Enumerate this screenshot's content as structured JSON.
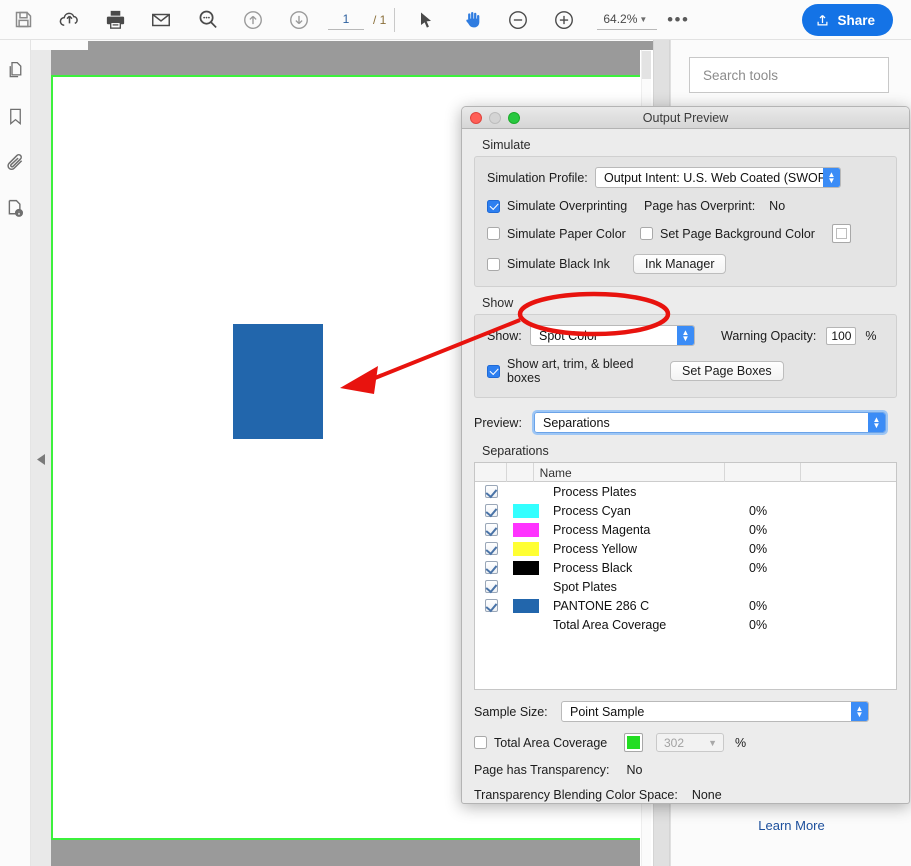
{
  "toolbar": {
    "icons": [
      "save-icon",
      "cloud-upload-icon",
      "print-icon",
      "email-icon",
      "search-zoom-icon",
      "page-up-icon",
      "page-down-icon",
      "select-cursor-icon",
      "hand-tool-icon",
      "zoom-out-icon",
      "zoom-in-icon"
    ],
    "page_number": "1",
    "page_total": "/ 1",
    "zoom_level": "64.2%",
    "more_label": "•••",
    "share_label": "Share"
  },
  "left_rail": {
    "items": [
      "page-thumbnails-icon",
      "bookmarks-icon",
      "attachments-icon",
      "document-info-icon"
    ]
  },
  "right_panel": {
    "search_placeholder": "Search tools",
    "learn_more_label": "Learn More"
  },
  "dialog": {
    "title": "Output Preview",
    "traffic_lights": [
      "close",
      "minimize",
      "zoom"
    ],
    "simulate": {
      "group_label": "Simulate",
      "profile_label": "Simulation Profile:",
      "profile_value": "Output Intent: U.S. Web Coated (SWOP)…",
      "overprint_checkbox_label": "Simulate Overprinting",
      "overprint_checked": true,
      "page_has_overprint_label": "Page has Overprint:",
      "page_has_overprint_value": "No",
      "paper_color_label": "Simulate Paper Color",
      "paper_color_checked": false,
      "set_page_bg_label": "Set Page Background Color",
      "set_page_bg_checked": false,
      "black_ink_label": "Simulate Black Ink",
      "black_ink_checked": false,
      "ink_manager_label": "Ink Manager"
    },
    "show": {
      "group_label": "Show",
      "show_label": "Show:",
      "show_value": "Spot Color",
      "warning_opacity_label": "Warning Opacity:",
      "warning_opacity_value": "100",
      "percent_label": "%",
      "boxes_checkbox_label": "Show art, trim, & bleed boxes",
      "boxes_checked": true,
      "set_page_boxes_label": "Set Page Boxes"
    },
    "preview": {
      "label": "Preview:",
      "value": "Separations"
    },
    "separations": {
      "group_label": "Separations",
      "columns": [
        "",
        "",
        "Name",
        "",
        ""
      ],
      "rows": [
        {
          "checked": true,
          "swatch": null,
          "name": "Process Plates",
          "pct": ""
        },
        {
          "checked": true,
          "swatch": "#33ffff",
          "name": "Process Cyan",
          "pct": "0%"
        },
        {
          "checked": true,
          "swatch": "#ff33ff",
          "name": "Process Magenta",
          "pct": "0%"
        },
        {
          "checked": true,
          "swatch": "#ffff33",
          "name": "Process Yellow",
          "pct": "0%"
        },
        {
          "checked": true,
          "swatch": "#000000",
          "name": "Process Black",
          "pct": "0%"
        },
        {
          "checked": true,
          "swatch": null,
          "name": "Spot Plates",
          "pct": ""
        },
        {
          "checked": true,
          "swatch": "#2266ac",
          "name": "PANTONE 286 C",
          "pct": "0%"
        },
        {
          "checked": false,
          "swatch": null,
          "name": "Total Area Coverage",
          "pct": "0%"
        }
      ]
    },
    "footer": {
      "sample_size_label": "Sample Size:",
      "sample_size_value": "Point Sample",
      "tac_checkbox_label": "Total Area Coverage",
      "tac_checked": false,
      "tac_swatch_color": "#22dd22",
      "tac_value": "302",
      "tac_percent_label": "%",
      "transparency_label": "Page has Transparency:",
      "transparency_value": "No",
      "blending_label": "Transparency Blending Color Space:",
      "blending_value": "None"
    }
  },
  "annotations": {
    "highlight_color": "#e8130e",
    "ellipse_target": "show-dropdown",
    "arrow_target": "blue-rectangle"
  },
  "document": {
    "spot_rect_color": "#2266ac",
    "guide_color": "#3cf03c"
  }
}
